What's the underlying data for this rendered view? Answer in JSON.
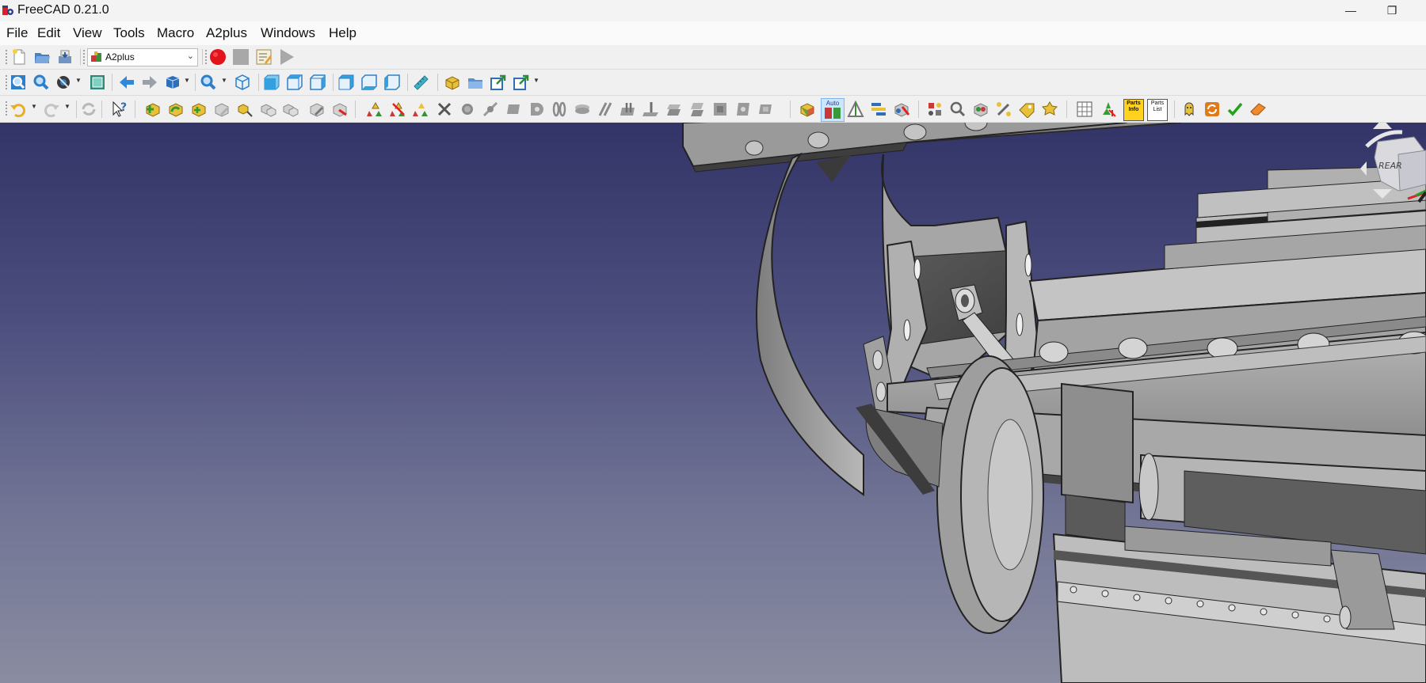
{
  "window": {
    "title": "FreeCAD 0.21.0",
    "minimize_glyph": "—",
    "restore_glyph": "❐"
  },
  "menu": {
    "items": [
      {
        "label": "File"
      },
      {
        "label": "Edit"
      },
      {
        "label": "View"
      },
      {
        "label": "Tools"
      },
      {
        "label": "Macro"
      },
      {
        "label": "A2plus"
      },
      {
        "label": "Windows"
      },
      {
        "label": "Help"
      }
    ]
  },
  "toolbar": {
    "workbench_selector": {
      "value": "A2plus"
    },
    "auto_label": "Auto",
    "parts_info_label": "Parts\nInfo",
    "parts_list_label": "Parts\nList"
  },
  "colors": {
    "record_macro": "#e0141a",
    "viewport_top": "#333467",
    "viewport_bottom": "#8a8ca1",
    "part_gray": "#9a9a9a",
    "check": "#27a020"
  },
  "navigation_cube": {
    "face_label": "REAR"
  }
}
